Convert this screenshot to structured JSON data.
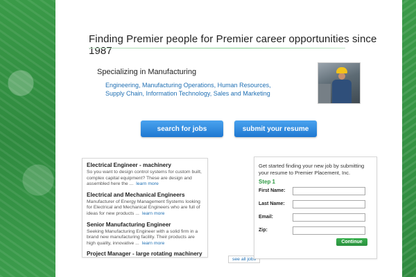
{
  "header": {
    "headline": "Finding Premier people for Premier career opportunities since 1987"
  },
  "specialty": {
    "title": "Specializing in Manufacturing",
    "fields_line1": "Engineering, Manufacturing Operations, Human Resources,",
    "fields_line2": "Supply Chain, Information Technology, Sales and Marketing"
  },
  "actions": {
    "search_label": "search for jobs",
    "submit_label": "submit your resume"
  },
  "jobs": {
    "items": [
      {
        "title": "Electrical Engineer - machinery",
        "desc": "So you want to design control systems for custom built, complex capital equipment? These are design and assembled here the ...",
        "learn": "learn more"
      },
      {
        "title": "Electrical and Mechanical Engineers",
        "desc": "Manufacturer of Energy Management Systems looking for Electrical and Mechanical Engineers who are full of ideas for new products ...",
        "learn": "learn more"
      },
      {
        "title": "Senior Manufacturing Engineer",
        "desc": "Seeking Manufacturing Engineer with a solid firm in a brand new manufacturing facility. Their products are high quality, innovative ...",
        "learn": "learn more"
      },
      {
        "title": "Project Manager - large rotating machinery",
        "desc": "",
        "learn": ""
      }
    ],
    "see_all": "see all jobs"
  },
  "signup": {
    "intro": "Get started finding your new job by submitting your resume to Premier Placement, Inc.",
    "step": "Step 1",
    "first_name_label": "First Name:",
    "last_name_label": "Last Name:",
    "email_label": "Email:",
    "zip_label": "Zip:",
    "continue_label": "Continue"
  },
  "colors": {
    "brand_green": "#3f9a4f",
    "link_blue": "#1f6fb3",
    "button_blue": "#1f78d1"
  }
}
